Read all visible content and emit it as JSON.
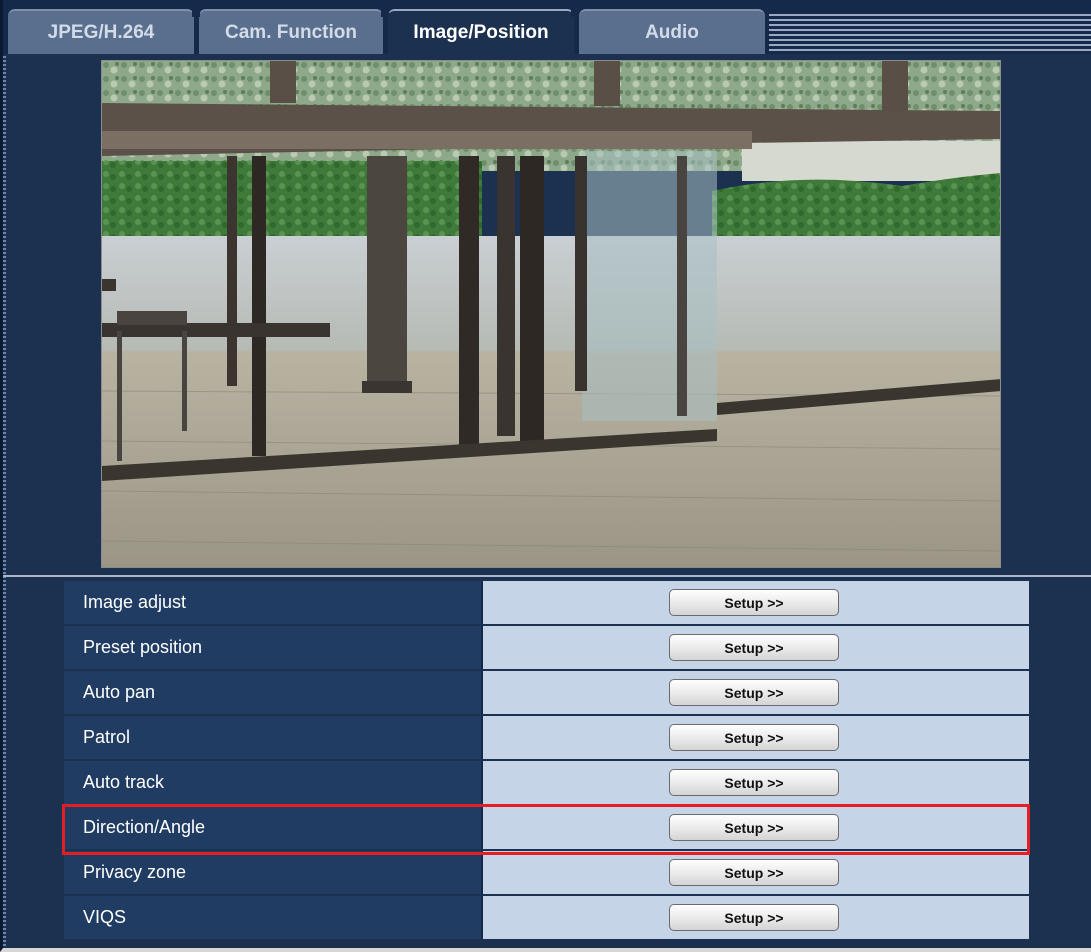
{
  "tabs": [
    {
      "label": "JPEG/H.264",
      "active": false
    },
    {
      "label": "Cam. Function",
      "active": false
    },
    {
      "label": "Image/Position",
      "active": true
    },
    {
      "label": "Audio",
      "active": false
    }
  ],
  "settings": {
    "rows": [
      {
        "label": "Image adjust",
        "button": "Setup >>"
      },
      {
        "label": "Preset position",
        "button": "Setup >>"
      },
      {
        "label": "Auto pan",
        "button": "Setup >>"
      },
      {
        "label": "Patrol",
        "button": "Setup >>"
      },
      {
        "label": "Auto track",
        "button": "Setup >>"
      },
      {
        "label": "Direction/Angle",
        "button": "Setup >>"
      },
      {
        "label": "Privacy zone",
        "button": "Setup >>"
      },
      {
        "label": "VIQS",
        "button": "Setup >>"
      }
    ]
  },
  "highlighted_row": "Direction/Angle",
  "colors": {
    "panel": "#1c3150",
    "label_cell": "#213c63",
    "button_cell": "#c6d4e8",
    "highlight": "#e31e24"
  }
}
